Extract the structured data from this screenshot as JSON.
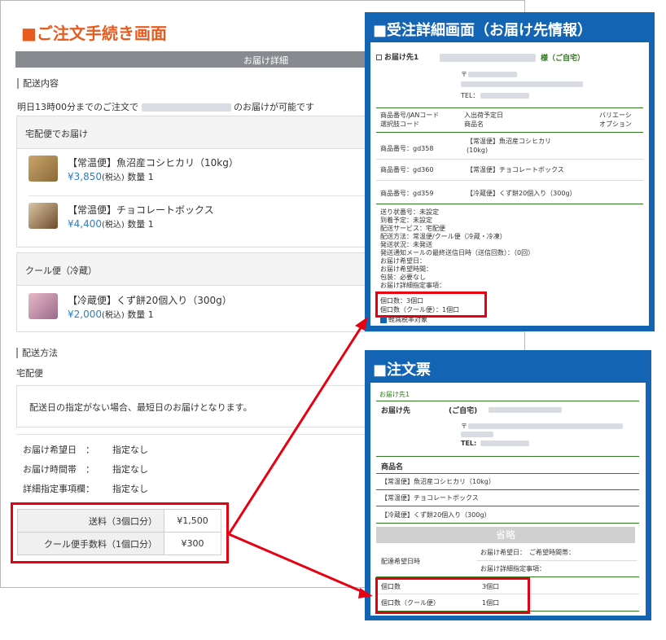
{
  "order_screen": {
    "title": "■ご注文手続き画面",
    "bar_label": "お届け詳細",
    "delivery_heading": "配送内容",
    "delivery_note_prefix": "明日13時00分までのご注文で",
    "delivery_note_suffix": "のお届けが可能です",
    "groups": [
      {
        "label": "宅配便でお届け",
        "items": [
          {
            "name": "【常温便】魚沼産コシヒカリ（10kg）",
            "price": "¥3,850",
            "tax": "(税込)",
            "qty": "数量 1"
          },
          {
            "name": "【常温便】チョコレートボックス",
            "price": "¥4,400",
            "tax": "(税込)",
            "qty": "数量 1"
          }
        ]
      },
      {
        "label": "クール便（冷蔵）",
        "items": [
          {
            "name": "【冷蔵便】くず餅20個入り（300g）",
            "price": "¥2,000",
            "tax": "(税込)",
            "qty": "数量 1"
          }
        ]
      }
    ],
    "method_heading": "配送方法",
    "method_value": "宅配便",
    "method_note": "配送日の指定がない場合、最短日のお届けとなります。",
    "details": [
      {
        "key": "お届け希望日　：",
        "value": "指定なし"
      },
      {
        "key": "お届け時間帯　：",
        "value": "指定なし"
      },
      {
        "key": "詳細指定事項欄：",
        "value": "指定なし"
      }
    ],
    "fees": [
      {
        "label": "送料（3個口分）",
        "value": "¥1,500"
      },
      {
        "label": "クール便手数料（1個口分）",
        "value": "¥300"
      }
    ]
  },
  "order_detail_panel": {
    "title": "■受注詳細画面（お届け先情報）",
    "dest_label": "お届け先1",
    "dest_suffix": "様（ご自宅）",
    "postal_mark": "〒",
    "tel_label": "TEL：",
    "col_headers": [
      "商品番号/JANコード",
      "入出荷予定日",
      "バリエーシ",
      "選択肢コード",
      "商品名",
      "オプション"
    ],
    "rows": [
      {
        "code": "商品番号：gd358",
        "name1": "【常温便】魚沼産コシヒカリ",
        "name2": "(10kg)"
      },
      {
        "code": "商品番号：gd360",
        "name1": "【常温便】チョコレートボックス",
        "name2": ""
      },
      {
        "code": "商品番号：gd359",
        "name1": "【冷蔵便】くず餅20個入り（300g）",
        "name2": ""
      }
    ],
    "status_lines": [
      "送り状番号：未設定",
      "到着予定：未設定",
      "配送サービス：宅配便",
      "配送方法：常温便/クール便（冷蔵・冷凍）",
      "発送状況：未発送",
      "発送通知メールの最終送信日時（送信回数）：（0回）",
      "お届け希望日：",
      "お届け希望時間：",
      "包装：必要なし",
      "お届け詳細指定事項："
    ],
    "boxes_line": "個口数：3個口",
    "cool_boxes_line": "個口数（クール便）：1個口",
    "tax_line": "軽減税率対象"
  },
  "invoice_panel": {
    "title": "■注文票",
    "dest_label": "お届け先1",
    "ship_to_label": "お届け先",
    "ship_to_value": "(ご自宅)",
    "postal_mark": "〒",
    "tel_label": "TEL:",
    "product_header": "商品名",
    "products": [
      "【常温便】魚沼産コシヒカリ（10kg）",
      "【常温便】チョコレートボックス",
      "【冷蔵便】くず餅20個入り（300g）"
    ],
    "omitted_label": "省略",
    "date_label": "配達希望日時",
    "wish_date": "お届け希望日：　ご希望時間帯：",
    "detail_instr": "お届け詳細指定事項：",
    "boxes_label": "個口数",
    "boxes_value": "3個口",
    "cool_label": "個口数（クール便）",
    "cool_value": "1個口"
  },
  "colors": {
    "accent_orange": "#e85a1e",
    "panel_blue": "#1464b4",
    "highlight_red": "#e60012",
    "line_green": "#2f7a1f",
    "price_blue": "#2a7fc2"
  }
}
